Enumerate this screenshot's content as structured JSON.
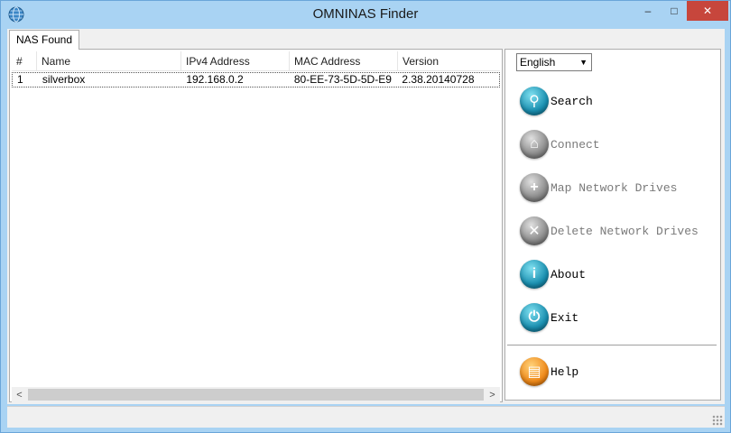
{
  "window": {
    "title": "OMNINAS Finder",
    "minimize": "–",
    "maximize": "□",
    "close": "✕"
  },
  "tabs": [
    {
      "label": "NAS Found"
    }
  ],
  "table": {
    "columns": [
      "#",
      "Name",
      "IPv4 Address",
      "MAC Address",
      "Version"
    ],
    "rows": [
      {
        "num": "1",
        "name": "silverbox",
        "ip": "192.168.0.2",
        "mac": "80-EE-73-5D-5D-E9",
        "version": "2.38.20140728"
      }
    ]
  },
  "scroll": {
    "left": "<",
    "right": ">"
  },
  "language": {
    "selected": "English"
  },
  "actions": [
    {
      "label": "Search",
      "enabled": true,
      "icon": "search-icon",
      "glyph": "⚲"
    },
    {
      "label": "Connect",
      "enabled": false,
      "icon": "home-icon",
      "glyph": "⌂"
    },
    {
      "label": "Map Network Drives",
      "enabled": false,
      "icon": "plus-icon",
      "glyph": "+"
    },
    {
      "label": "Delete Network Drives",
      "enabled": false,
      "icon": "x-icon",
      "glyph": "✕"
    },
    {
      "label": "About",
      "enabled": true,
      "icon": "info-icon",
      "glyph": "i"
    },
    {
      "label": "Exit",
      "enabled": true,
      "icon": "power-icon",
      "glyph": "⏻"
    },
    {
      "label": "Help",
      "enabled": true,
      "icon": "book-icon",
      "glyph": "▤"
    }
  ],
  "colors": {
    "accent": "#1a8fb0",
    "close": "#c7463c",
    "frame": "#a9d3f3"
  }
}
